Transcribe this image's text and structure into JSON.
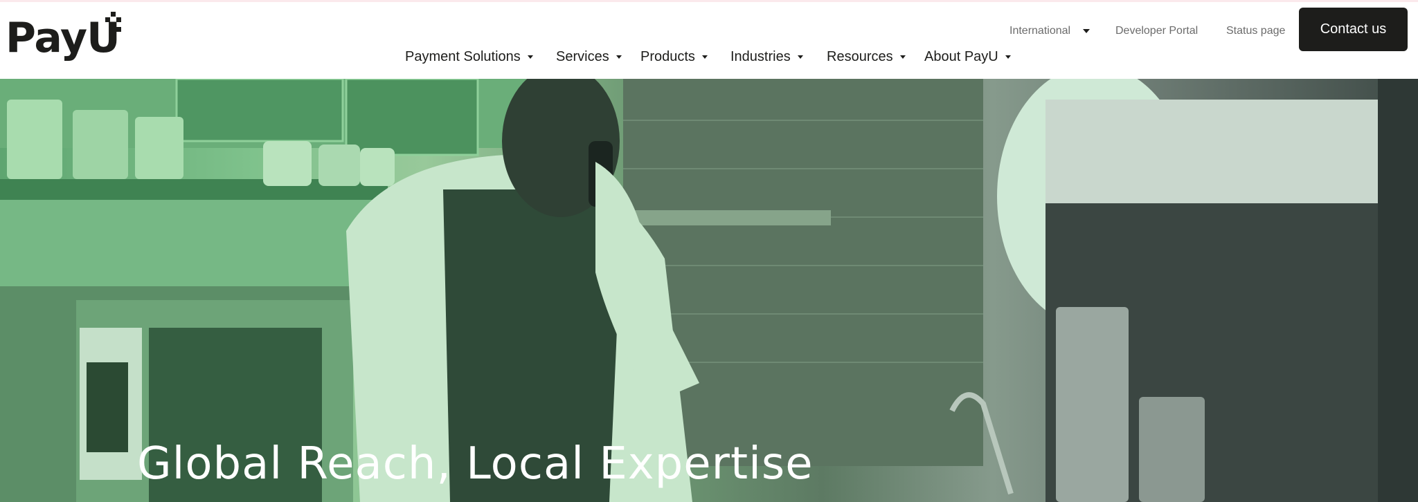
{
  "brand": {
    "name": "PayU"
  },
  "utility_nav": {
    "country": "International",
    "developer_portal": "Developer Portal",
    "status_page": "Status page"
  },
  "contact_button": "Contact us",
  "main_nav": [
    {
      "label": "Payment Solutions"
    },
    {
      "label": "Services"
    },
    {
      "label": "Products"
    },
    {
      "label": "Industries"
    },
    {
      "label": "Resources"
    },
    {
      "label": "About PayU"
    }
  ],
  "hero": {
    "title": "Global Reach, Local Expertise"
  },
  "colors": {
    "brand_dark": "#1d1d1b",
    "hero_green": "#7fc28c",
    "utility_text": "#6b6b6b"
  }
}
